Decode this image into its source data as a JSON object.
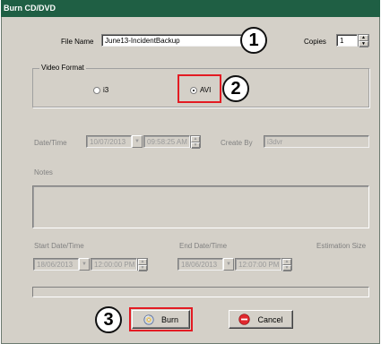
{
  "window": {
    "title": "Burn CD/DVD"
  },
  "file": {
    "label": "File Name",
    "value": "June13-IncidentBackup"
  },
  "copies": {
    "label": "Copies",
    "value": "1"
  },
  "video_format": {
    "label": "Video Format",
    "options": [
      {
        "label": "i3",
        "selected": false
      },
      {
        "label": "AVI",
        "selected": true
      }
    ]
  },
  "datetime": {
    "label": "Date/Time",
    "date": "10/07/2013",
    "time": "09:58:25 AM"
  },
  "create_by": {
    "label": "Create By",
    "value": "i3dvr"
  },
  "notes": {
    "label": "Notes"
  },
  "range": {
    "start_label": "Start Date/Time",
    "start_date": "18/06/2013",
    "start_time": "12:00:00 PM",
    "end_label": "End Date/Time",
    "end_date": "18/06/2013",
    "end_time": "12:07:00 PM",
    "estimation_label": "Estimation Size"
  },
  "buttons": {
    "burn": "Burn",
    "cancel": "Cancel"
  },
  "callouts": {
    "one": "1",
    "two": "2",
    "three": "3"
  },
  "colors": {
    "titlebar": "#1f5f44",
    "highlight": "#e31b23",
    "dialog": "#d4d0c8"
  },
  "icons": {
    "burn": "disc-burn-icon",
    "cancel": "cancel-icon"
  }
}
